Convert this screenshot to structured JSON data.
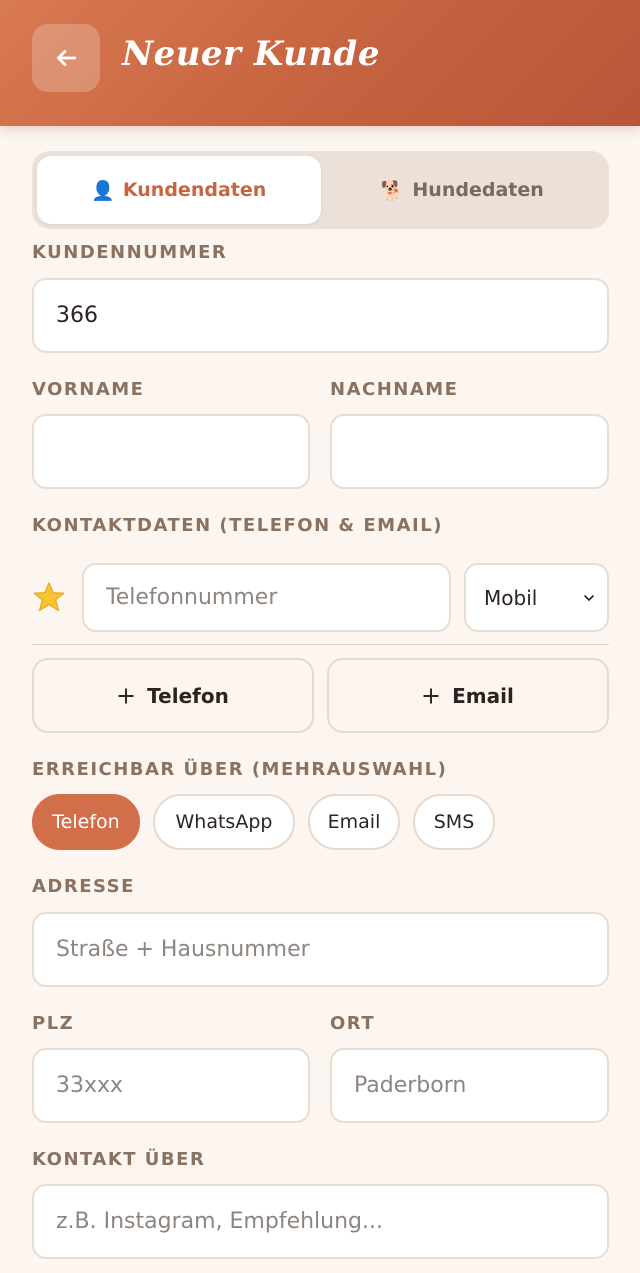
{
  "header": {
    "title": "Neuer Kunde",
    "back_icon": "arrow-left-icon"
  },
  "tabs": [
    {
      "label": "Kundendaten",
      "icon": "👤",
      "active": true
    },
    {
      "label": "Hundedaten",
      "icon": "🐕",
      "active": false
    }
  ],
  "form": {
    "kundennummer": {
      "label": "KUNDENNUMMER",
      "value": "366"
    },
    "vorname": {
      "label": "VORNAME",
      "value": "",
      "placeholder": ""
    },
    "nachname": {
      "label": "NACHNAME",
      "value": "",
      "placeholder": ""
    },
    "kontakt": {
      "label": "KONTAKTDATEN (TELEFON & EMAIL)",
      "phone_placeholder": "Telefonnummer",
      "phone_type": "Mobil",
      "add_phone": "Telefon",
      "add_email": "Email"
    },
    "erreichbar": {
      "label": "ERREICHBAR ÜBER (MEHRAUSWAHL)",
      "options": [
        {
          "label": "Telefon",
          "selected": true
        },
        {
          "label": "WhatsApp",
          "selected": false
        },
        {
          "label": "Email",
          "selected": false
        },
        {
          "label": "SMS",
          "selected": false
        }
      ]
    },
    "adresse": {
      "label": "ADRESSE",
      "placeholder": "Straße + Hausnummer"
    },
    "plz": {
      "label": "PLZ",
      "placeholder": "33xxx"
    },
    "ort": {
      "label": "ORT",
      "placeholder": "Paderborn"
    },
    "kontakt_ueber": {
      "label": "KONTAKT ÜBER",
      "placeholder": "z.B. Instagram, Empfehlung..."
    }
  },
  "colors": {
    "accent": "#d36e4b",
    "header": "#c5623f",
    "background": "#fdf5ef"
  }
}
